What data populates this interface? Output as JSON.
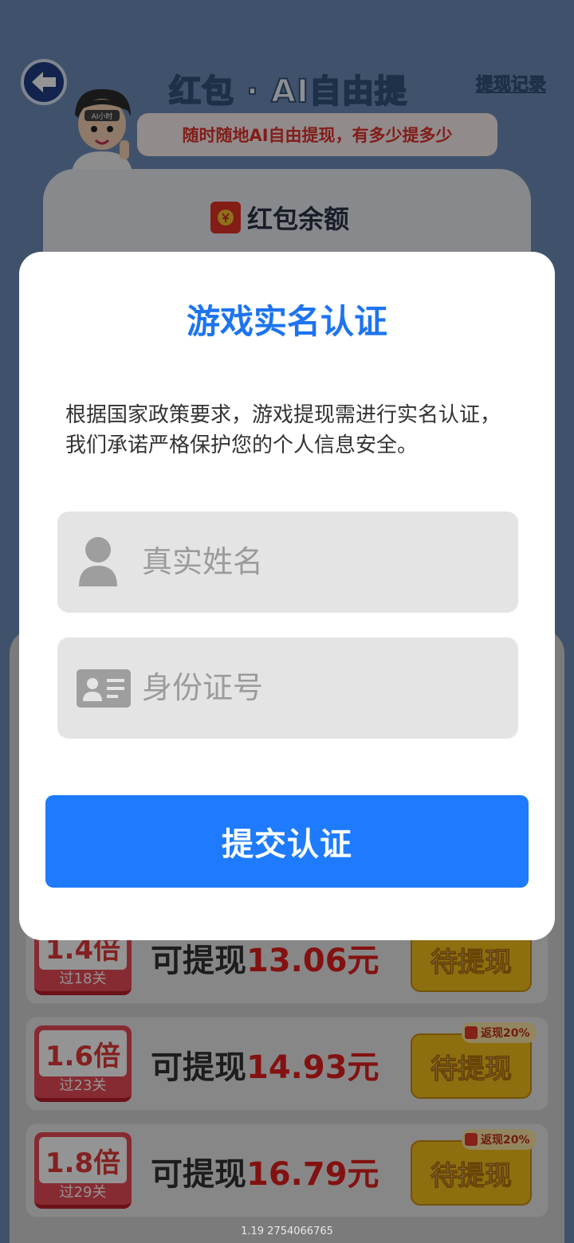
{
  "header": {
    "title": "红包 · AI自由提",
    "record_link": "提现记录",
    "back_icon": "arrow-left-icon"
  },
  "mascot": {
    "badge": "AI小时"
  },
  "bubble": {
    "text": "随时随地AI自由提现，有多少提多少"
  },
  "balance": {
    "label": "红包余额",
    "icon": "red-envelope-icon"
  },
  "withdraw_rows": [
    {
      "multiplier": "1.4倍",
      "level": "过18关",
      "label": "可提现",
      "amount": "13.06元",
      "button": "待提现",
      "rebate": ""
    },
    {
      "multiplier": "1.6倍",
      "level": "过23关",
      "label": "可提现",
      "amount": "14.93元",
      "button": "待提现",
      "rebate": "返现20%"
    },
    {
      "multiplier": "1.8倍",
      "level": "过29关",
      "label": "可提现",
      "amount": "16.79元",
      "button": "待提现",
      "rebate": "返现20%"
    }
  ],
  "version": "1.19 2754066765",
  "modal": {
    "title": "游戏实名认证",
    "description": "根据国家政策要求，游戏提现需进行实名认证，我们承诺严格保护您的个人信息安全。",
    "name_field": {
      "placeholder": "真实姓名",
      "value": "",
      "icon": "user-icon"
    },
    "id_field": {
      "placeholder": "身份证号",
      "value": "",
      "icon": "id-card-icon"
    },
    "submit_label": "提交认证"
  },
  "colors": {
    "accent": "#1e7bfd",
    "title": "#1e74f0",
    "field_bg": "#e4e4e4",
    "amount_red": "#e0201e",
    "button_yellow": "#f4c01c"
  }
}
